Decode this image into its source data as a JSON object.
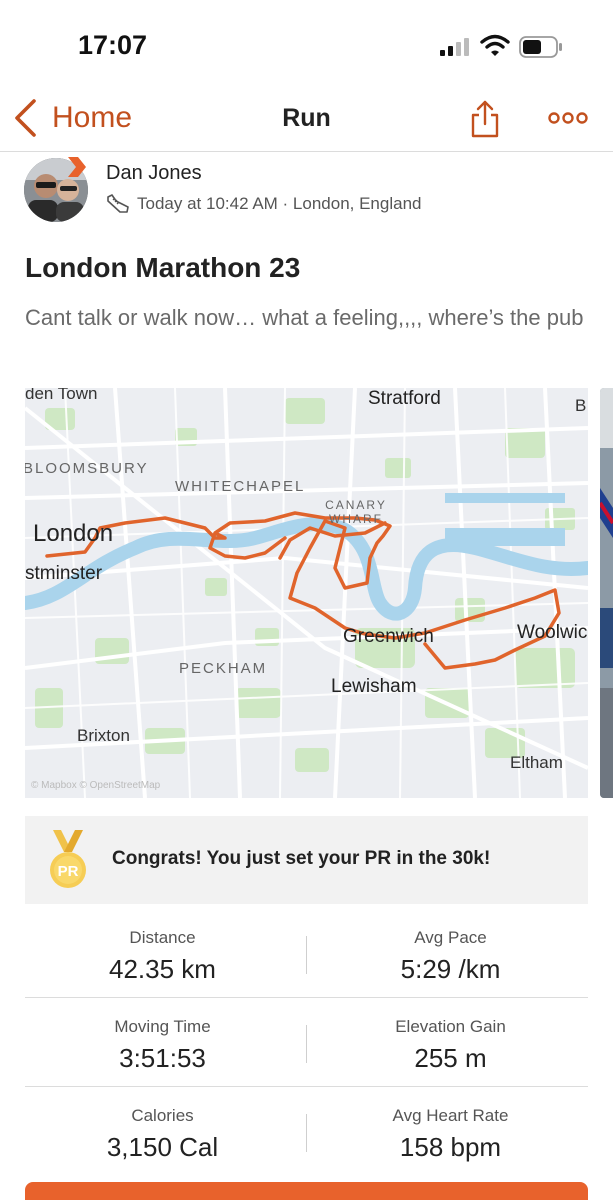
{
  "status_bar": {
    "time": "17:07"
  },
  "nav": {
    "back_label": "Home",
    "title": "Run"
  },
  "athlete": {
    "name": "Dan Jones",
    "meta": "Today at 10:42 AM · London, England"
  },
  "activity": {
    "title": "London Marathon 23",
    "description": "Cant talk or walk now… what a feeling,,,, where’s the pub"
  },
  "map": {
    "labels": {
      "camden": "den Town",
      "stratford": "Stratford",
      "b": "B",
      "bloomsbury": "BLOOMSBURY",
      "whitechapel": "WHITECHAPEL",
      "london": "London",
      "westminster": "stminster",
      "canary_wharf": "CANARY WHARF",
      "greenwich": "Greenwich",
      "woolwich": "Woolwic",
      "peckham": "PECKHAM",
      "lewisham": "Lewisham",
      "brixton": "Brixton",
      "eltham": "Eltham",
      "attribution": "© Mapbox © OpenStreetMap"
    }
  },
  "achievement": {
    "badge": "PR",
    "message": "Congrats! You just set your PR in the 30k!"
  },
  "stats": {
    "distance": {
      "label": "Distance",
      "value": "42.35 km"
    },
    "avg_pace": {
      "label": "Avg Pace",
      "value": "5:29 /km"
    },
    "moving_time": {
      "label": "Moving Time",
      "value": "3:51:53"
    },
    "elevation_gain": {
      "label": "Elevation Gain",
      "value": "255 m"
    },
    "calories": {
      "label": "Calories",
      "value": "3,150 Cal"
    },
    "avg_heart_rate": {
      "label": "Avg Heart Rate",
      "value": "158 bpm"
    }
  },
  "colors": {
    "accent": "#c2501e",
    "route": "#e0642c",
    "river": "#aad4ec",
    "park": "#cfe8c4",
    "cta": "#e8622c"
  },
  "icons": [
    "cellular-signal-icon",
    "wifi-icon",
    "battery-icon",
    "chevron-left-icon",
    "share-icon",
    "more-icon",
    "shoe-icon",
    "medal-icon"
  ]
}
